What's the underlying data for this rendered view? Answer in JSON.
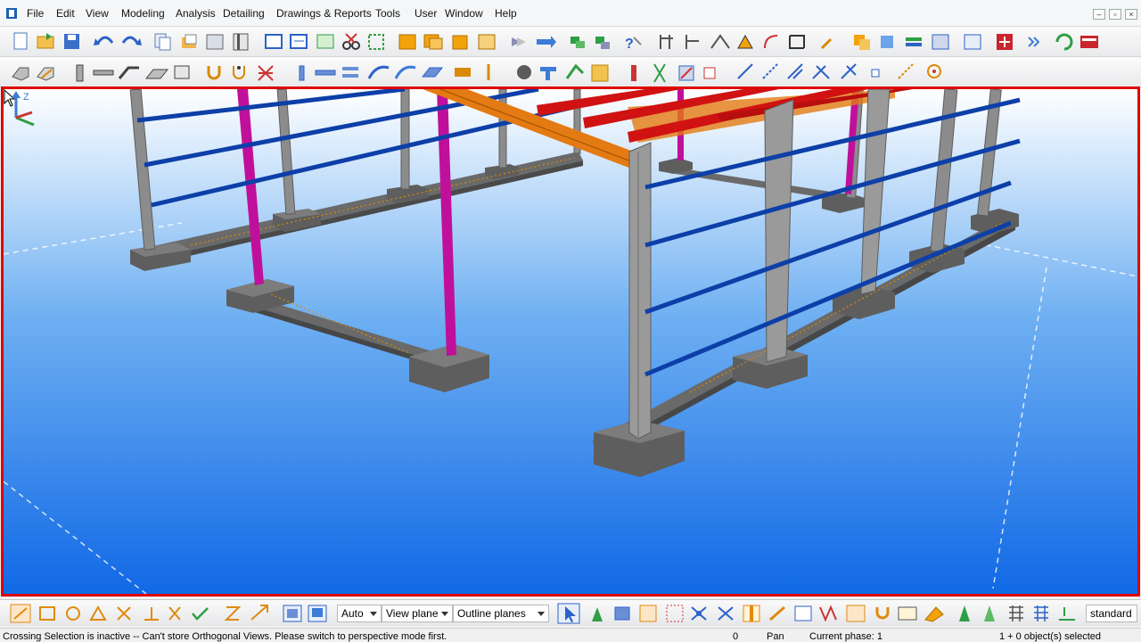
{
  "menu": {
    "items": [
      "File",
      "Edit",
      "View",
      "Modeling",
      "Analysis",
      "Detailing",
      "Drawings & Reports",
      "Tools",
      "User",
      "Window",
      "Help"
    ]
  },
  "window_controls": {
    "minimize": "–",
    "restore": "▫",
    "close": "×"
  },
  "bottombar": {
    "pick_mode": "Auto",
    "plane": "View plane",
    "planes_display": "Outline planes",
    "std_setting": "standard"
  },
  "status": {
    "message": "Crossing Selection is inactive -- Can't store Orthogonal Views. Please switch to perspective mode first.",
    "count": "0",
    "mode": "Pan",
    "phase": "Current phase: 1",
    "selection": "1 + 0 object(s) selected"
  },
  "colors": {
    "viewport_border": "#e00000",
    "sky_top": "#ffffff",
    "sky_bottom": "#1169e6",
    "column": "#8c8c8c",
    "purlin_blue": "#0d3fa8",
    "brace_magenta": "#c0109b",
    "rafter_orange": "#e47a12",
    "beam_red": "#d11212",
    "footing": "#5e5e5e"
  }
}
